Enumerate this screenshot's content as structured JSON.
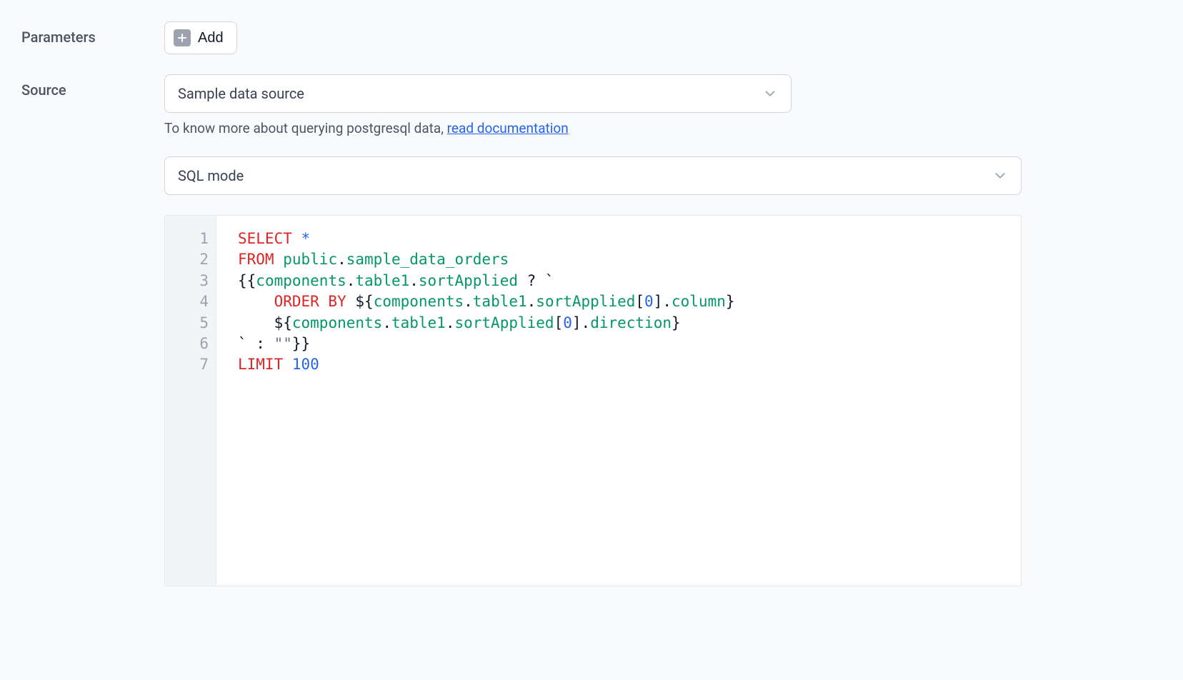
{
  "parameters": {
    "label": "Parameters",
    "add_button": "Add"
  },
  "source": {
    "label": "Source",
    "selected": "Sample data source",
    "hint_prefix": "To know more about querying postgresql data, ",
    "hint_link": "read documentation"
  },
  "mode": {
    "selected": "SQL mode"
  },
  "code": {
    "line_numbers": [
      "1",
      "2",
      "3",
      "4",
      "5",
      "6",
      "7"
    ],
    "tokens": {
      "select": "SELECT",
      "star": "*",
      "from": "FROM",
      "schema": "public",
      "dot": ".",
      "table": "sample_data_orders",
      "tpl_open": "{{",
      "expr_components": "components",
      "expr_table1": "table1",
      "expr_sortApplied": "sortApplied",
      "question": " ? ",
      "backtick": "`",
      "order_by": "ORDER BY",
      "interp_open": "${",
      "bracket_open": "[",
      "zero": "0",
      "bracket_close": "]",
      "expr_column": "column",
      "brace_close": "}",
      "expr_direction": "direction",
      "colon": " : ",
      "empty_str": "\"\"",
      "tpl_close": "}}",
      "limit": "LIMIT",
      "limit_val": "100"
    }
  }
}
